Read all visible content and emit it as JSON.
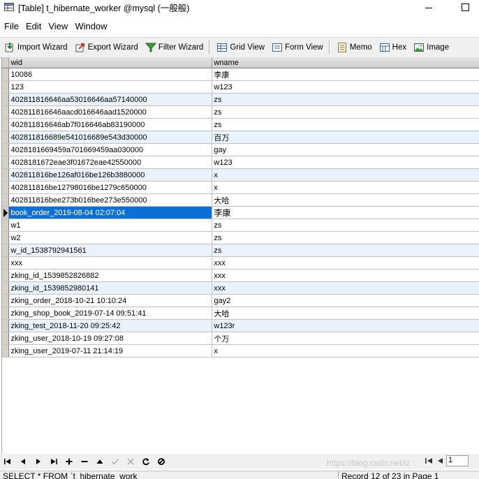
{
  "window": {
    "title": "[Table] t_hibernate_worker @mysql (一般般)"
  },
  "menu": [
    "File",
    "Edit",
    "View",
    "Window"
  ],
  "toolbar": {
    "import_wizard": "Import Wizard",
    "export_wizard": "Export Wizard",
    "filter_wizard": "Filter Wizard",
    "grid_view": "Grid View",
    "form_view": "Form View",
    "memo": "Memo",
    "hex": "Hex",
    "image": "Image"
  },
  "grid": {
    "columns": [
      "wid",
      "wname"
    ],
    "selected_row_index": 11,
    "rows": [
      [
        "10086",
        "李康"
      ],
      [
        "123",
        "w123"
      ],
      [
        "402811816646aa53016646aa57140000",
        "zs"
      ],
      [
        "402811816646aacd016646aad1520000",
        "zs"
      ],
      [
        "402811816646ab7f016646ab83190000",
        "zs"
      ],
      [
        "402811816689e541016689e543d30000",
        "百万"
      ],
      [
        "4028181669459a701669459aa030000",
        "gay"
      ],
      [
        "4028181672eae3f01672eae42550000",
        "w123"
      ],
      [
        "402811816be126af016be126b3880000",
        "x"
      ],
      [
        "402811816be12798016be1279c650000",
        "x"
      ],
      [
        "402811816bee273b016bee273e550000",
        "大哈"
      ],
      [
        "book_order_2019-08-04 02:07:04",
        "李康"
      ],
      [
        "w1",
        "zs"
      ],
      [
        "w2",
        "zs"
      ],
      [
        "w_id_1538792941561",
        "zs"
      ],
      [
        "xxx",
        "xxx"
      ],
      [
        "zking_id_1539852826882",
        "xxx"
      ],
      [
        "zking_id_1539852980141",
        "xxx"
      ],
      [
        "zking_order_2018-10-21 10:10:24",
        "gay2"
      ],
      [
        "zking_shop_book_2019-07-14 09:51:41",
        "大哈"
      ],
      [
        "zking_test_2018-11-20 09:25:42",
        "w123r"
      ],
      [
        "zking_user_2018-10-19 09:27:08",
        "个万"
      ],
      [
        "zking_user_2019-07-11 21:14:19",
        "x"
      ]
    ]
  },
  "navigation": {
    "watermark": "https://blog.csdn.net/lz",
    "page_number": "1"
  },
  "status": {
    "sql": "SELECT * FROM `t_hibernate_work",
    "record_info": "Record 12 of 23 in Page 1"
  },
  "colors": {
    "selection": "#0a6fd6",
    "alt_row": "#eaf3fb",
    "toolbar_bg": "#f0f0f0"
  }
}
